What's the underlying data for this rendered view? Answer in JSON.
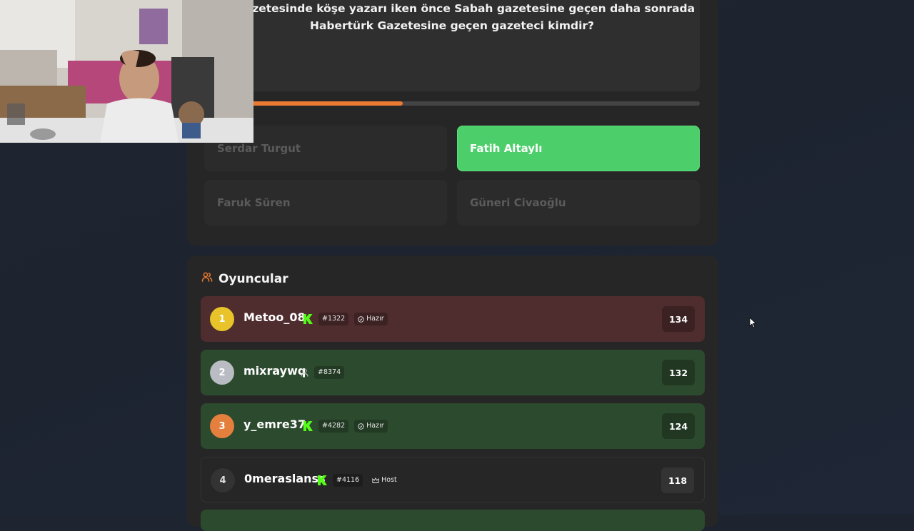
{
  "question": {
    "text_line1": "iyet gazetesinde köşe yazarı iken önce Sabah gazetesine geçen daha sonrada",
    "text_line2": "Habertürk Gazetesine geçen gazeteci kimdir?"
  },
  "progress": {
    "fraction": 0.4,
    "color": "#ea7a32"
  },
  "answers": [
    {
      "label": "Serdar Turgut",
      "state": "dim"
    },
    {
      "label": "Fatih Altaylı",
      "state": "correct"
    },
    {
      "label": "Faruk Süren",
      "state": "dim"
    },
    {
      "label": "Güneri Civaoğlu",
      "state": "dim"
    }
  ],
  "players_section": {
    "title": "Oyuncular",
    "icon": "users-icon",
    "accent": "#ea7a32"
  },
  "players": [
    {
      "rank": "1",
      "name": "Metoo_08",
      "verified": true,
      "id": "#1322",
      "status": "Hazır",
      "status_icon": "check-circle-icon",
      "score": "134",
      "row_color": "#4f2c2e",
      "badge_color": "#e8c32a"
    },
    {
      "rank": "2",
      "name": "mixraywq",
      "verified": false,
      "user_icon": "user-icon",
      "id": "#8374",
      "status": "",
      "score": "132",
      "row_color": "#2c4a2e",
      "badge_color": "#b9bcc3"
    },
    {
      "rank": "3",
      "name": "y_emre37",
      "verified": true,
      "id": "#4282",
      "status": "Hazır",
      "status_icon": "check-circle-icon",
      "score": "124",
      "row_color": "#2c4a2e",
      "badge_color": "#e57f3e"
    },
    {
      "rank": "4",
      "name": "0meraslanss",
      "verified": true,
      "id": "#4116",
      "status": "Host",
      "status_icon": "crown-icon",
      "score": "118",
      "row_color": "#262626",
      "badge_color": "#2f2f2f"
    }
  ],
  "colors": {
    "correct": "#4ccf6a",
    "verified": "#53fc18"
  }
}
